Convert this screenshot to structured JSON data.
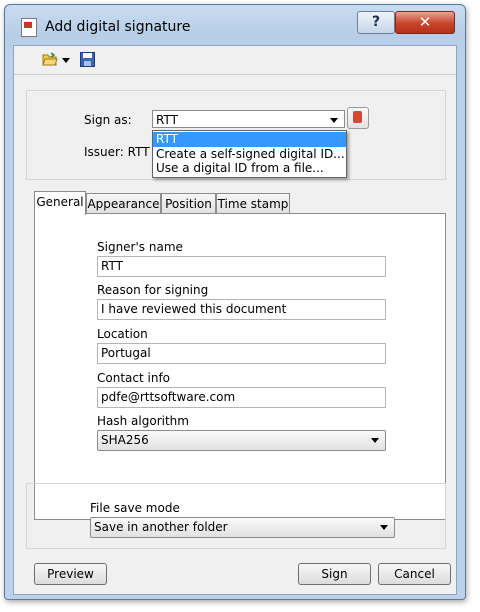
{
  "window": {
    "title": "Add digital signature",
    "help_label": "?",
    "close_label": "✕"
  },
  "toolbar": {
    "open_icon": "folder-open-icon",
    "save_icon": "save-disk-icon"
  },
  "signer": {
    "sign_as_label": "Sign as:",
    "sign_as_value": "RTT",
    "issuer_label": "Issuer: RTT",
    "dropdown_options": [
      "RTT",
      "Create a self-signed digital ID...",
      "Use a digital ID from a file..."
    ]
  },
  "tabs": [
    "General",
    "Appearance",
    "Position",
    "Time stamp"
  ],
  "general": {
    "signers_name_label": "Signer's name",
    "signers_name_value": "RTT",
    "reason_label": "Reason for signing",
    "reason_value": "I have reviewed this document",
    "location_label": "Location",
    "location_value": "Portugal",
    "contact_label": "Contact info",
    "contact_value": "pdfe@rttsoftware.com",
    "hash_label": "Hash algorithm",
    "hash_value": "SHA256"
  },
  "save": {
    "mode_label": "File save mode",
    "mode_value": "Save in another folder"
  },
  "buttons": {
    "preview": "Preview",
    "sign": "Sign",
    "cancel": "Cancel"
  },
  "colors": {
    "selection": "#3399ff",
    "close_button": "#c7432a",
    "title_bar": "#c9dcef"
  }
}
